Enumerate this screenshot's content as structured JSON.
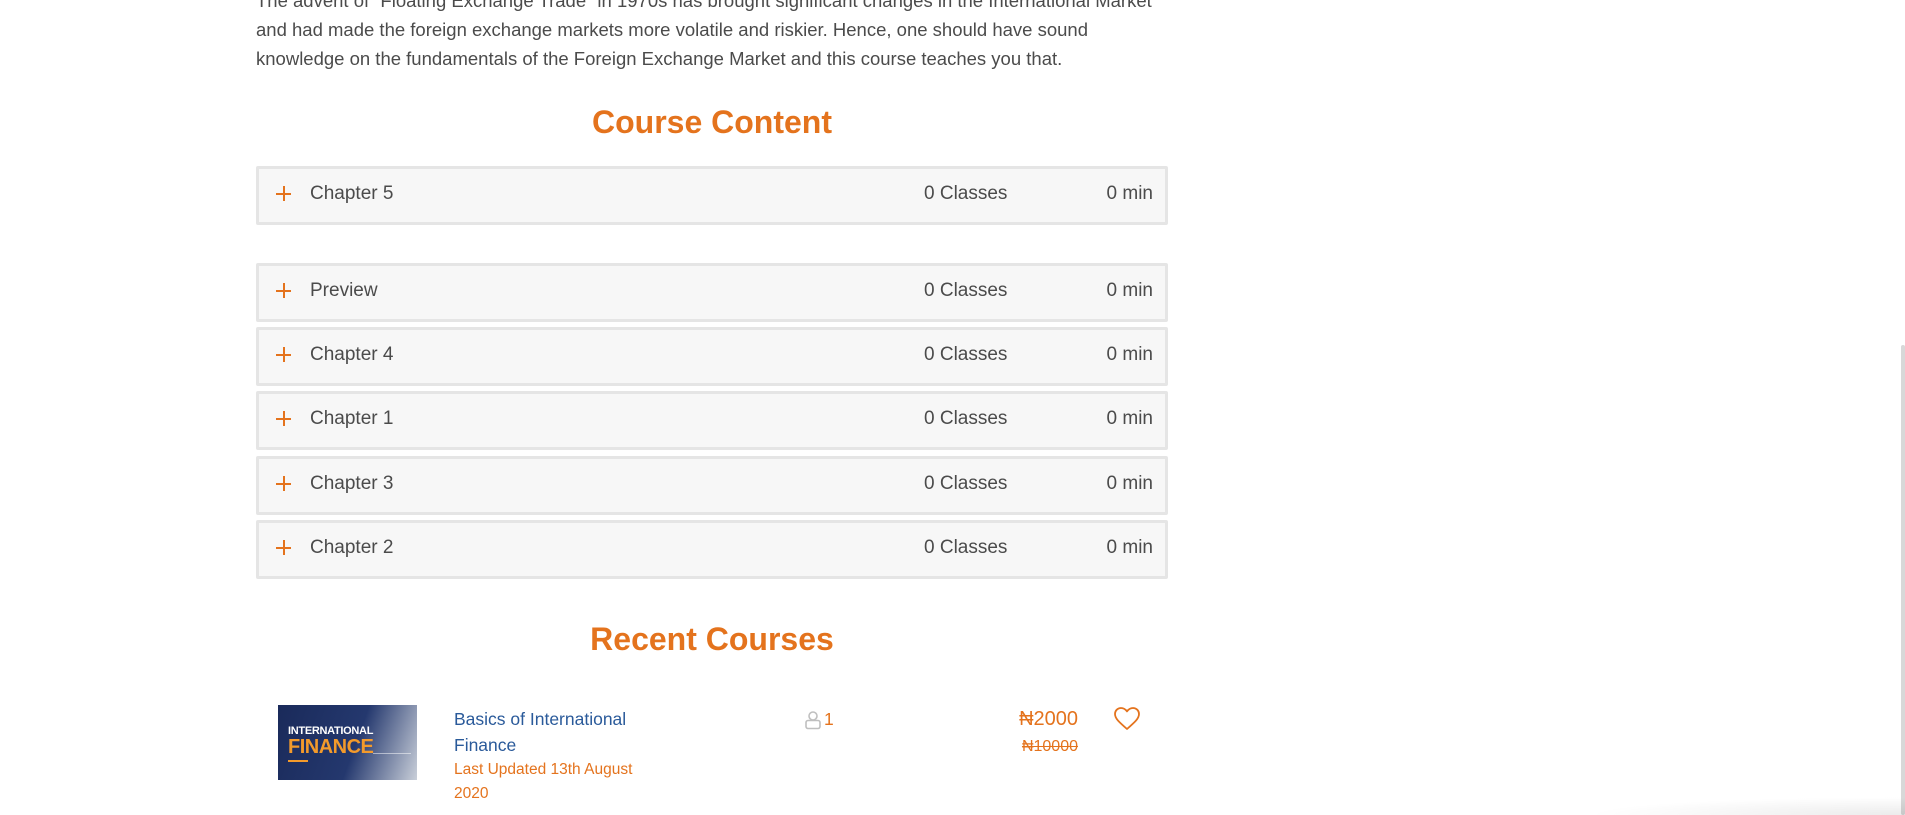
{
  "intro": {
    "line1": "The advent of “Floating Exchange Trade” in 1970s has brought significant changes in the International Market",
    "line2": "and had made the foreign exchange markets more volatile and riskier. Hence, one should have sound",
    "line3": "knowledge on the fundamentals of the Foreign Exchange Market and this course teaches you that."
  },
  "course_content": {
    "title": "Course Content",
    "chapters": [
      {
        "title": "Chapter 5",
        "classes": "0 Classes",
        "duration": "0 min"
      },
      {
        "title": "Preview",
        "classes": "0 Classes",
        "duration": "0 min"
      },
      {
        "title": "Chapter 4",
        "classes": "0 Classes",
        "duration": "0 min"
      },
      {
        "title": "Chapter 1",
        "classes": "0 Classes",
        "duration": "0 min"
      },
      {
        "title": "Chapter 3",
        "classes": "0 Classes",
        "duration": "0 min"
      },
      {
        "title": "Chapter 2",
        "classes": "0 Classes",
        "duration": "0 min"
      }
    ]
  },
  "recent_courses": {
    "title": "Recent Courses",
    "items": [
      {
        "thumbnail_line1": "INTERNATIONAL",
        "thumbnail_line2": "FINANCE",
        "title": "Basics of International Finance",
        "updated": "Last Updated 13th August 2020",
        "students": "1",
        "price": "₦2000",
        "old_price": "₦10000"
      }
    ]
  },
  "colors": {
    "accent": "#e4731d",
    "link": "#2a5a9a",
    "text": "#4b4b4b",
    "chapter_bg": "#f7f7f7",
    "chapter_border": "#e5e5e5"
  },
  "icons": {
    "expand": "plus-icon",
    "students": "user-icon",
    "wishlist": "heart-icon"
  }
}
